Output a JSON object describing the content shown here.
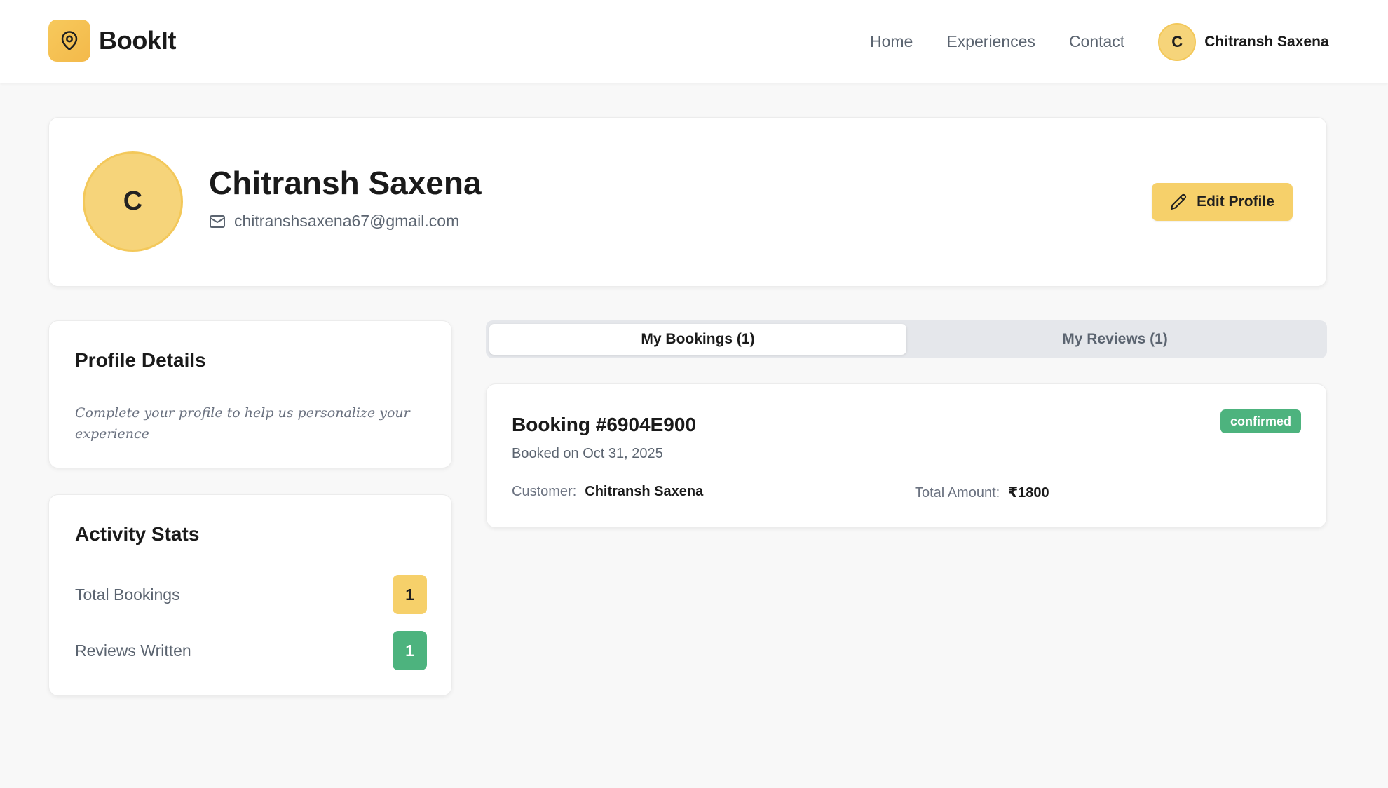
{
  "header": {
    "brand_name": "BookIt",
    "nav": [
      "Home",
      "Experiences",
      "Contact"
    ],
    "user": {
      "initial": "C",
      "name": "Chitransh Saxena"
    }
  },
  "profile": {
    "initial": "C",
    "name": "Chitransh Saxena",
    "email": "chitranshsaxena67@gmail.com",
    "edit_label": "Edit Profile"
  },
  "details": {
    "title": "Profile Details",
    "note": "Complete your profile to help us personalize your experience"
  },
  "stats": {
    "title": "Activity Stats",
    "items": [
      {
        "label": "Total Bookings",
        "value": "1",
        "color": "#f6d06a"
      },
      {
        "label": "Reviews Written",
        "value": "1",
        "color": "#4db37e"
      }
    ]
  },
  "tabs": [
    {
      "label": "My Bookings (1)",
      "active": true
    },
    {
      "label": "My Reviews (1)",
      "active": false
    }
  ],
  "booking": {
    "title": "Booking #6904E900",
    "date": "Booked on Oct 31, 2025",
    "status": "confirmed",
    "customer_label": "Customer:",
    "customer_value": "Chitransh Saxena",
    "amount_label": "Total Amount:",
    "amount_value": "₹1800"
  },
  "colors": {
    "accent": "#f6d06a",
    "success": "#4db37e",
    "background": "#f8f8f8"
  }
}
